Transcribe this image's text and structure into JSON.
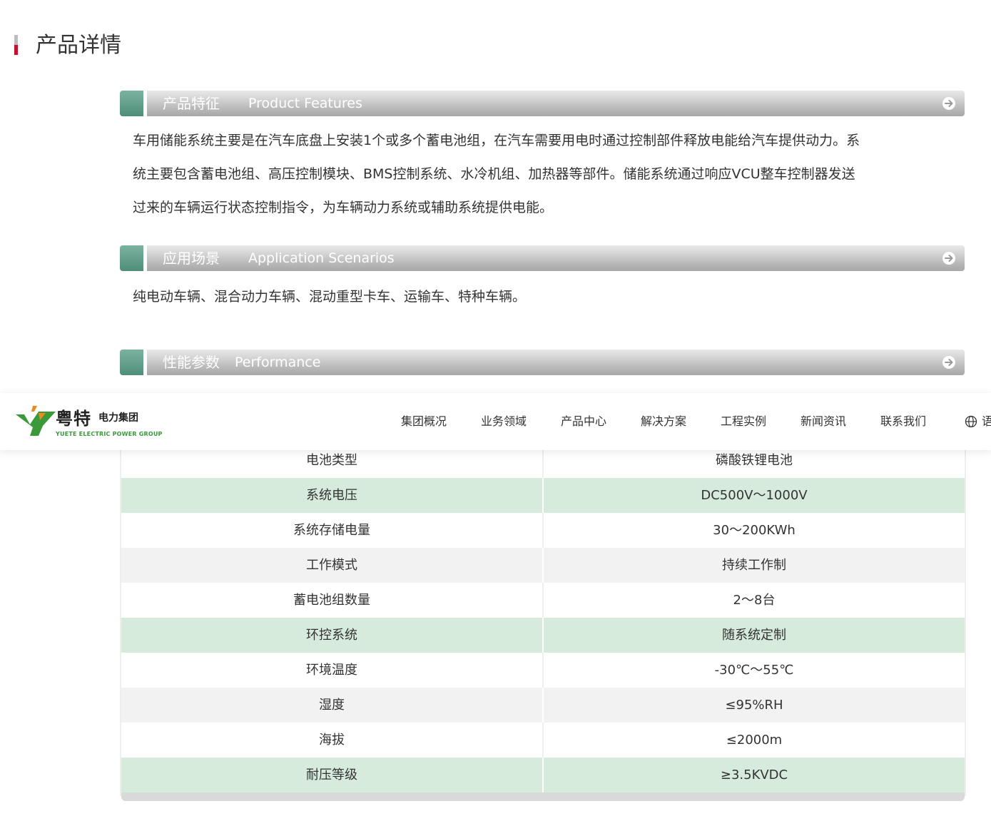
{
  "page": {
    "title": "产品详情"
  },
  "sections": {
    "features": {
      "title_zh": "产品特征",
      "title_en": "Product Features",
      "lines": [
        "车用储能系统主要是在汽车底盘上安装1个或多个蓄电池组，在汽车需要用电时通过控制部件释放电能给汽车提供动力。系",
        "统主要包含蓄电池组、高压控制模块、BMS控制系统、水冷机组、加热器等部件。储能系统通过响应VCU整车控制器发送",
        "过来的车辆运行状态控制指令，为车辆动力系统或辅助系统提供电能。"
      ]
    },
    "scenarios": {
      "title_zh": "应用场景",
      "title_en": "Application Scenarios",
      "text": "纯电动车辆、混合动力车辆、混动重型卡车、运输车、特种车辆。"
    },
    "performance": {
      "title_zh": "性能参数",
      "title_en": "Performance"
    }
  },
  "navbar": {
    "logo": {
      "brand_zh": "粤特",
      "group_zh": "电力集团",
      "brand_en": "YUETE ELECTRIC POWER GROUP"
    },
    "items": [
      {
        "label": "集团概况"
      },
      {
        "label": "业务领域"
      },
      {
        "label": "产品中心"
      },
      {
        "label": "解决方案"
      },
      {
        "label": "工程实例"
      },
      {
        "label": "新闻资讯"
      },
      {
        "label": "联系我们"
      }
    ],
    "language_label": "语"
  },
  "spec_table": {
    "rows": [
      {
        "name": "电池类型",
        "value": "磷酸铁锂电池"
      },
      {
        "name": "系统电压",
        "value": "DC500V～1000V"
      },
      {
        "name": "系统存储电量",
        "value": "30～200KWh"
      },
      {
        "name": "工作模式",
        "value": "持续工作制"
      },
      {
        "name": "蓄电池组数量",
        "value": "2～8台"
      },
      {
        "name": "环控系统",
        "value": "随系统定制"
      },
      {
        "name": "环境温度",
        "value": "-30℃～55℃"
      },
      {
        "name": "湿度",
        "value": "≤95%RH"
      },
      {
        "name": "海拔",
        "value": "≤2000m"
      },
      {
        "name": "耐压等级",
        "value": "≥3.5KVDC"
      }
    ]
  },
  "colors": {
    "accent_red": "#c8102e",
    "section_green": "#5a9a83",
    "row_green": "#d7ebdd",
    "row_gray": "#f2f2f2",
    "logo_green": "#3a9a3a",
    "logo_orange": "#f08a1c"
  },
  "icons": {
    "section_arrow": "arrow-right-circle-icon",
    "language": "globe-icon"
  }
}
